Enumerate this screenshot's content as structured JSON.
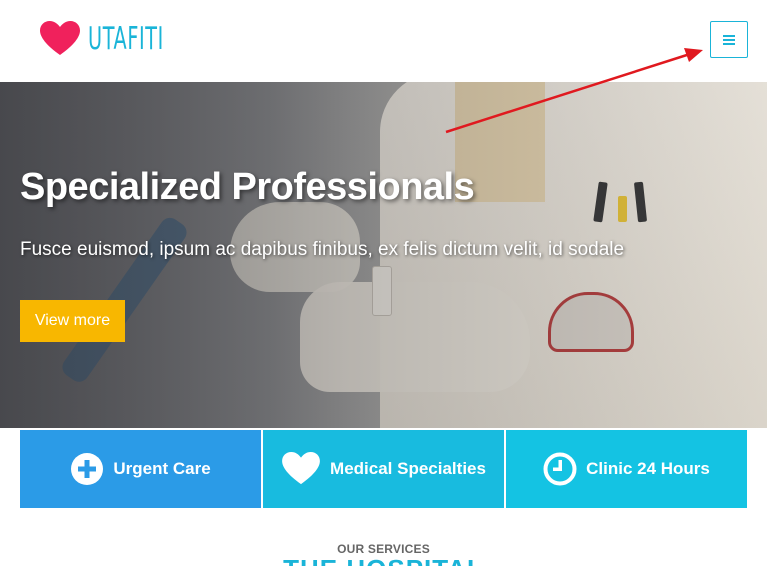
{
  "brand": {
    "name": "UTAFITI",
    "accent": "#1ab4d8",
    "heart_color": "#f0215c"
  },
  "header": {
    "menu_icon": "hamburger-icon"
  },
  "hero": {
    "title": "Specialized Professionals",
    "subtitle": "Fusce euismod, ipsum ac dapibus finibus, ex felis dictum velit, id sodale",
    "button_label": "View more",
    "button_color": "#f8b700"
  },
  "features": [
    {
      "label": "Urgent Care",
      "icon": "plus-circle-icon",
      "color": "#2b9be7"
    },
    {
      "label": "Medical Specialties",
      "icon": "heart-icon",
      "color": "#18bbdf"
    },
    {
      "label": "Clinic 24 Hours",
      "icon": "clock-icon",
      "color": "#14c3e3"
    }
  ],
  "services": {
    "kicker": "OUR SERVICES",
    "title": "THE HOSPITAL"
  },
  "annotation": {
    "arrow_color": "#e0191f"
  }
}
